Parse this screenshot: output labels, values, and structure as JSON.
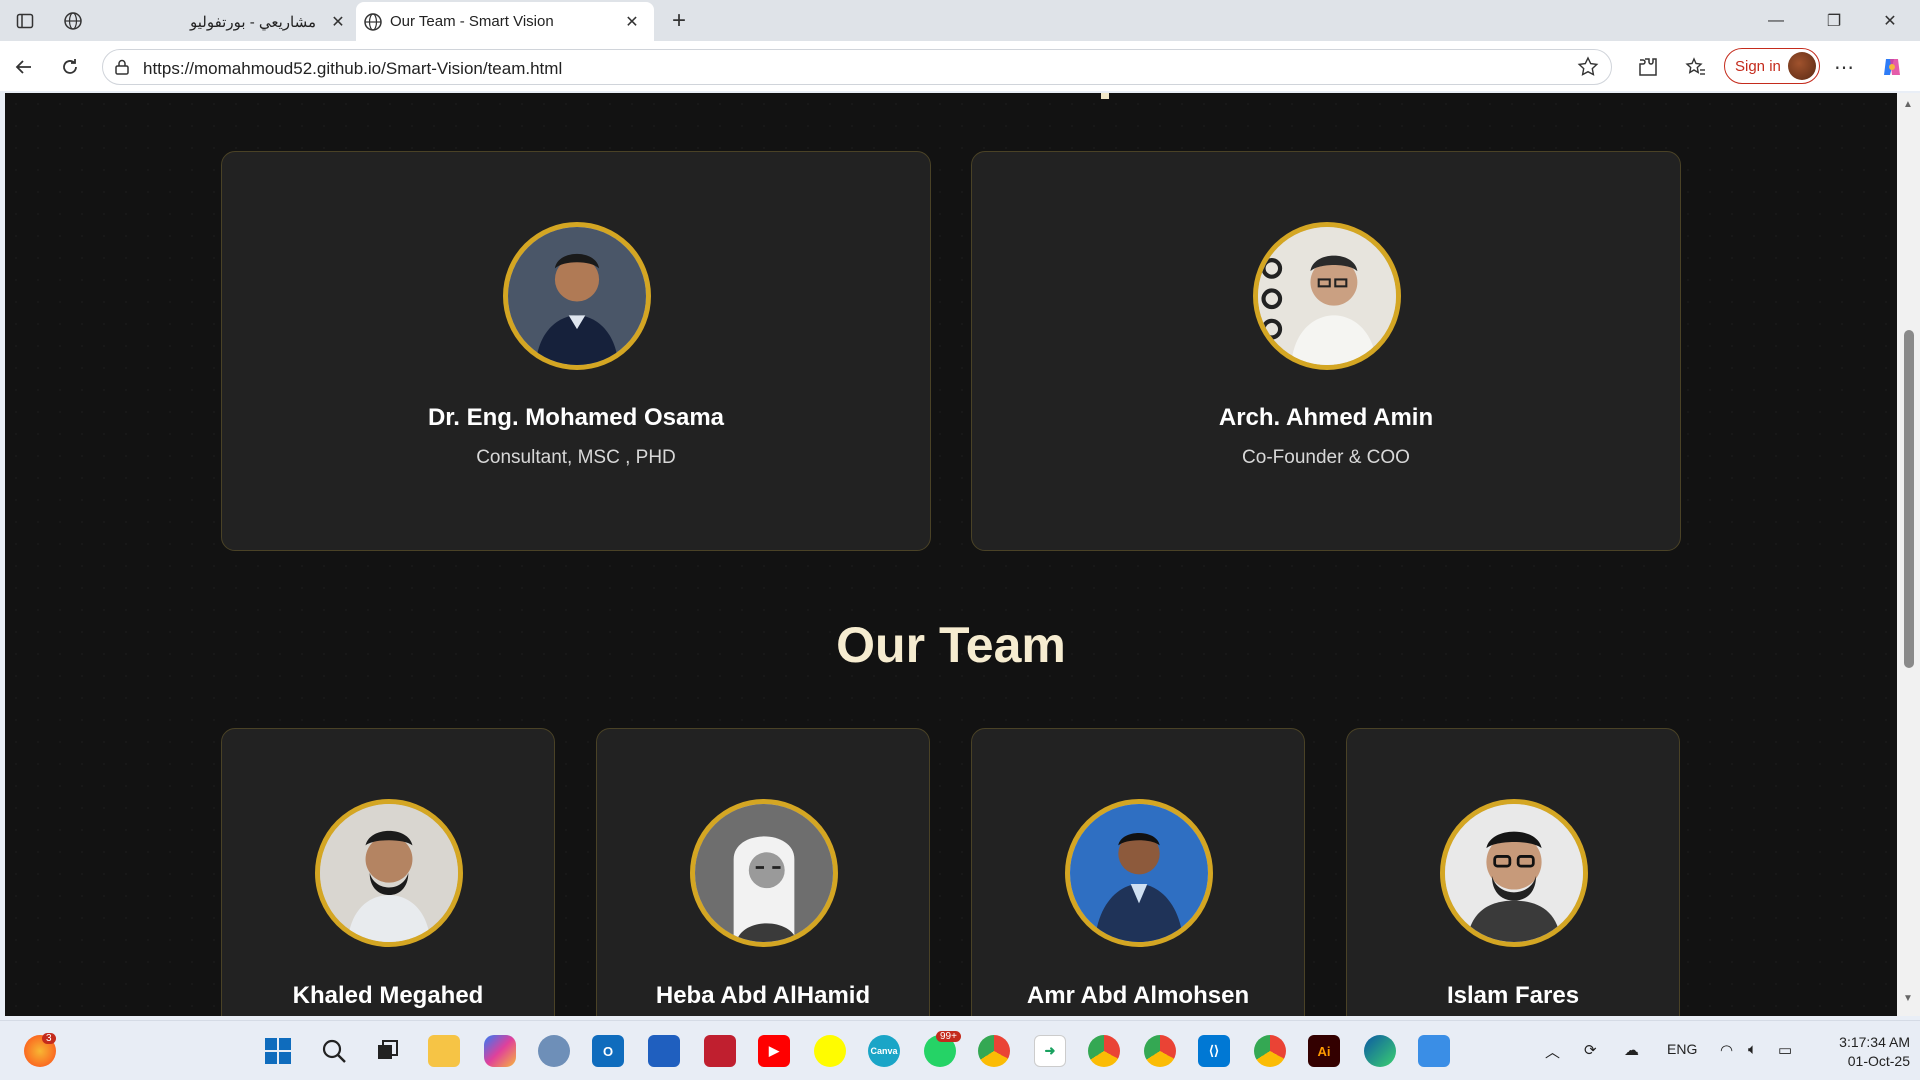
{
  "browser": {
    "tabs": [
      {
        "title": "مشاريعي - بورتفوليو",
        "active": false
      },
      {
        "title": "Our Team - Smart Vision",
        "active": true
      }
    ],
    "url": "https://momahmoud52.github.io/Smart-Vision/team.html",
    "sign_in_label": "Sign in"
  },
  "page": {
    "leadership": [
      {
        "name": "Dr. Eng. Mohamed Osama",
        "role": "Consultant, MSC , PHD"
      },
      {
        "name": "Arch. Ahmed Amin",
        "role": "Co-Founder & COO"
      }
    ],
    "team_heading": "Our Team",
    "team": [
      {
        "name": "Khaled Megahed"
      },
      {
        "name": "Heba Abd AlHamid"
      },
      {
        "name": "Amr Abd Almohsen"
      },
      {
        "name": "Islam Fares"
      }
    ],
    "accent_color": "#d4a623",
    "background_color": "#121212"
  },
  "taskbar": {
    "notification_badge": "3",
    "whatsapp_badge": "99+",
    "language": "ENG",
    "time": "3:17:34 AM",
    "date": "01-Oct-25"
  }
}
